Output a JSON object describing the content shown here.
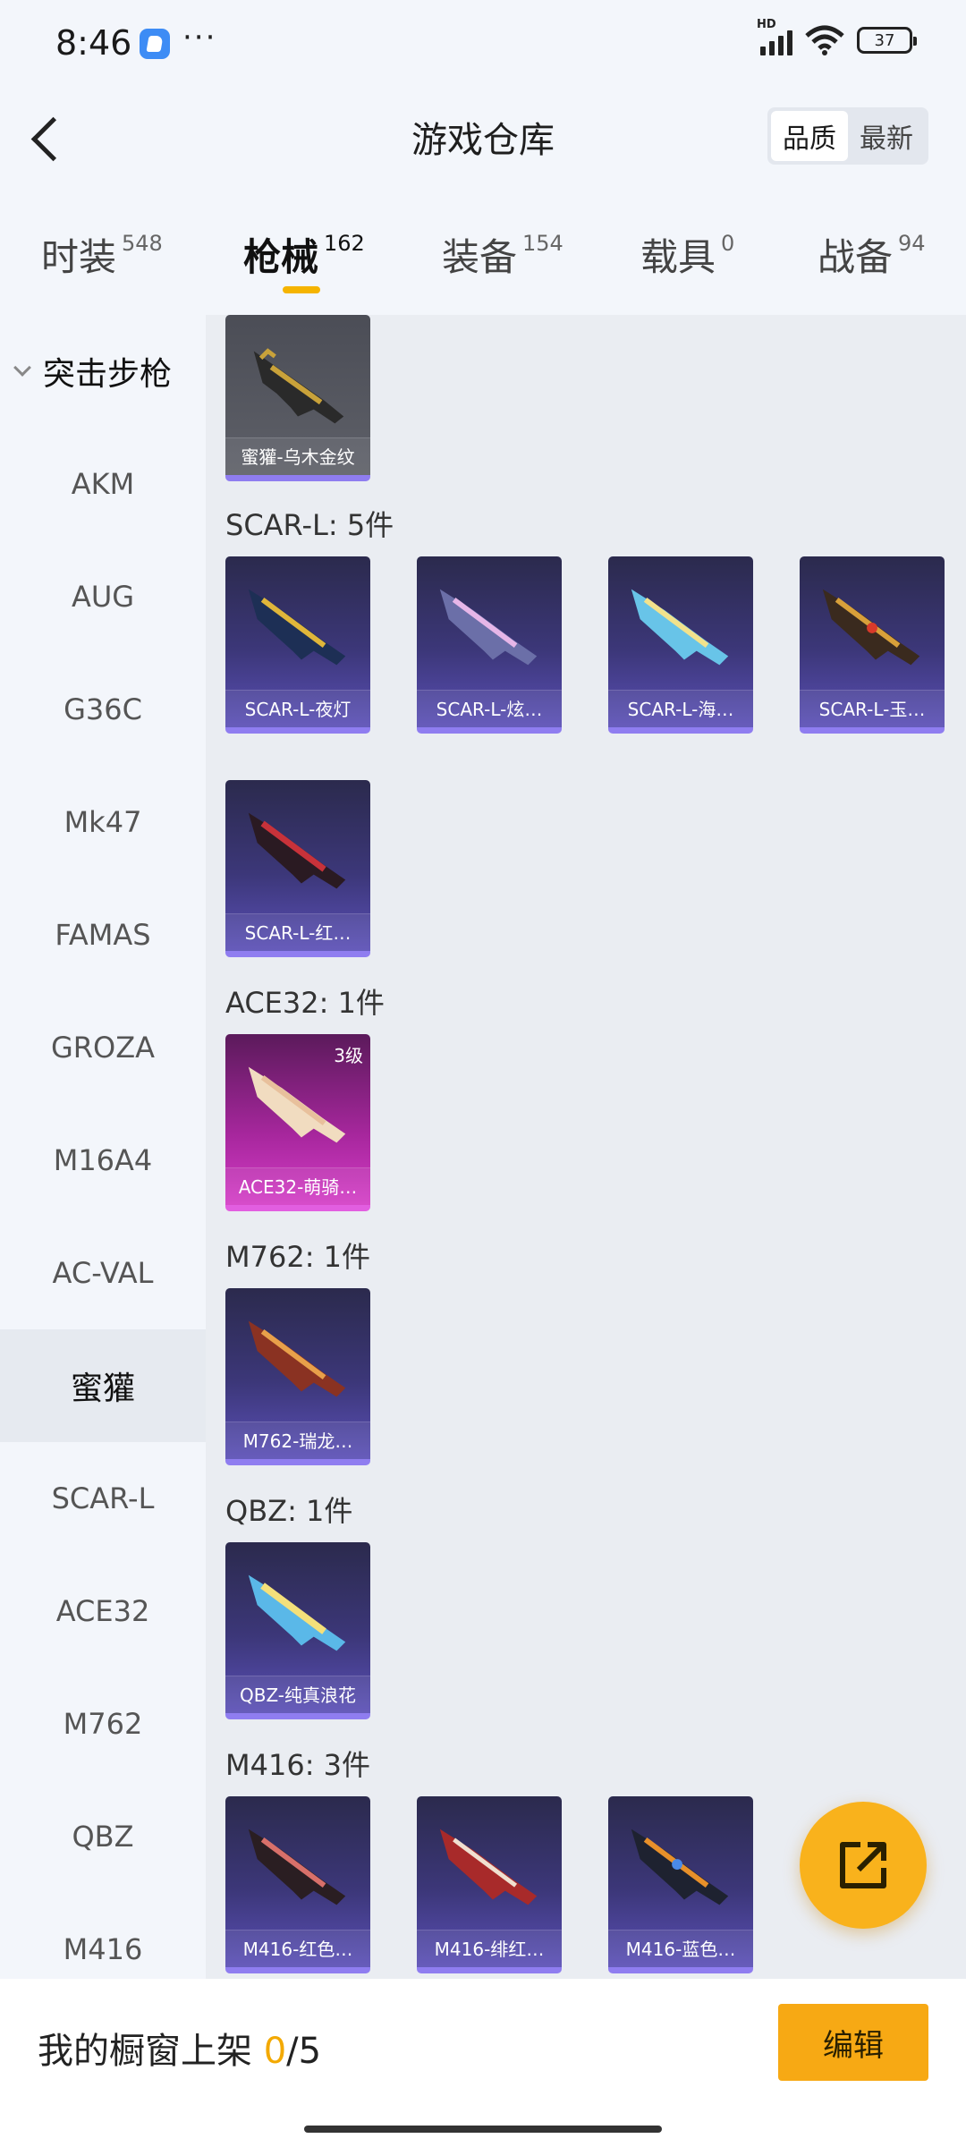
{
  "status_bar": {
    "time": "8:46",
    "dots": "···",
    "battery": "37",
    "hd": "HD"
  },
  "header": {
    "title": "游戏仓库",
    "sort_options": [
      "品质",
      "最新"
    ]
  },
  "tabs": [
    {
      "label": "时装",
      "count": "548"
    },
    {
      "label": "枪械",
      "count": "162"
    },
    {
      "label": "装备",
      "count": "154"
    },
    {
      "label": "载具",
      "count": "0"
    },
    {
      "label": "战备",
      "count": "94"
    }
  ],
  "sidebar": {
    "group": "突击步枪",
    "items": [
      "AKM",
      "AUG",
      "G36C",
      "Mk47",
      "FAMAS",
      "GROZA",
      "M16A4",
      "AC-VAL",
      "蜜獾",
      "SCAR-L",
      "ACE32",
      "M762",
      "QBZ",
      "M416"
    ],
    "active_index": 8
  },
  "sections": [
    {
      "title": "",
      "items": [
        {
          "name": "蜜獾-乌木金纹",
          "level": ""
        }
      ]
    },
    {
      "title": "SCAR-L: 5件",
      "items": [
        {
          "name": "SCAR-L-夜灯",
          "level": ""
        },
        {
          "name": "SCAR-L-炫…",
          "level": ""
        },
        {
          "name": "SCAR-L-海…",
          "level": ""
        },
        {
          "name": "SCAR-L-玉…",
          "level": ""
        },
        {
          "name": "SCAR-L-红…",
          "level": ""
        }
      ]
    },
    {
      "title": "ACE32: 1件",
      "items": [
        {
          "name": "ACE32-萌骑…",
          "level": "3级"
        }
      ]
    },
    {
      "title": "M762: 1件",
      "items": [
        {
          "name": "M762-瑞龙…",
          "level": ""
        }
      ]
    },
    {
      "title": "QBZ: 1件",
      "items": [
        {
          "name": "QBZ-纯真浪花",
          "level": ""
        }
      ]
    },
    {
      "title": "M416: 3件",
      "items": [
        {
          "name": "M416-红色…",
          "level": ""
        },
        {
          "name": "M416-绯红…",
          "level": ""
        },
        {
          "name": "M416-蓝色…",
          "level": ""
        }
      ]
    }
  ],
  "bottom": {
    "showcase_label": "我的橱窗上架 ",
    "current": "0",
    "total": "/5",
    "edit_label": "编辑"
  },
  "colors": {
    "accent": "#f5b400",
    "card_purple": "#3c3779",
    "card_pink": "#a8279e"
  }
}
